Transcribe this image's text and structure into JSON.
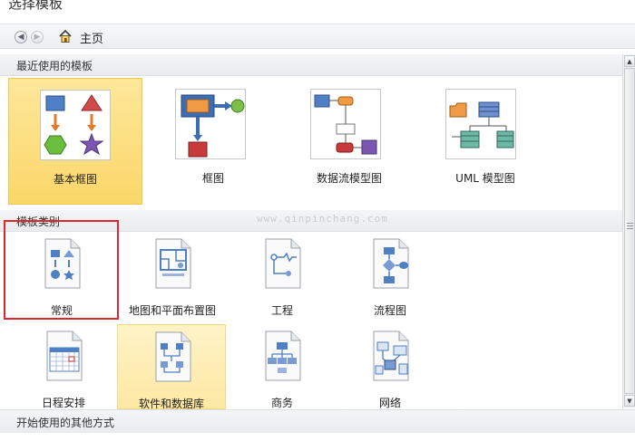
{
  "window": {
    "title": "选择模板"
  },
  "nav": {
    "back_icon": "back-arrow-icon",
    "forward_icon": "forward-arrow-icon",
    "home_icon": "home-icon",
    "breadcrumb": "主页"
  },
  "sections": {
    "recent": {
      "title": "最近使用的模板"
    },
    "categories": {
      "title": "模板类别"
    },
    "other": {
      "title": "开始使用的其他方式"
    }
  },
  "recent_templates": [
    {
      "label": "基本框图",
      "selected": true
    },
    {
      "label": "框图"
    },
    {
      "label": "数据流模型图"
    },
    {
      "label": "UML 模型图"
    }
  ],
  "categories": [
    {
      "label": "常规"
    },
    {
      "label": "地图和平面布置图"
    },
    {
      "label": "工程"
    },
    {
      "label": "流程图"
    },
    {
      "label": "日程安排"
    },
    {
      "label": "软件和数据库",
      "hover": true
    },
    {
      "label": "商务"
    },
    {
      "label": "网络"
    }
  ],
  "watermark": "www.qinpinchang.com",
  "colors": {
    "selected": "#fbd769",
    "highlight_box": "#e0262b"
  }
}
